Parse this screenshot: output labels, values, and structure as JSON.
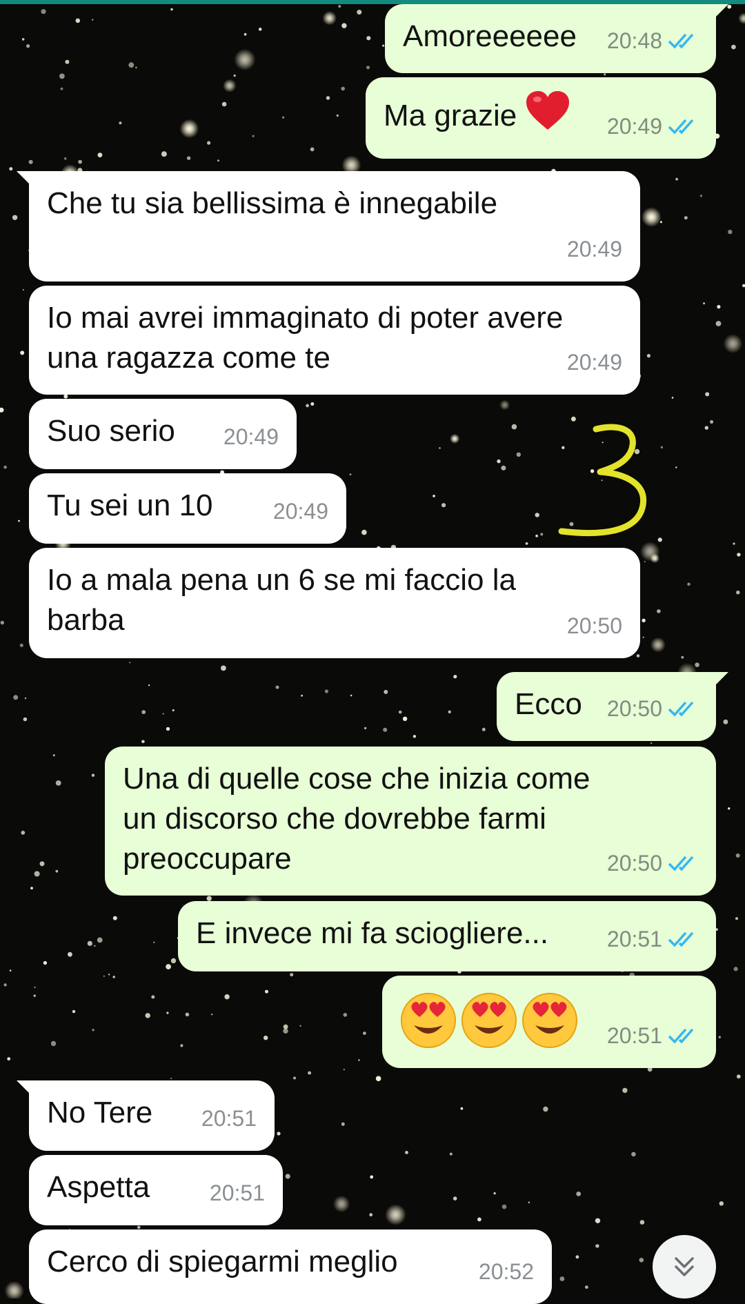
{
  "theme": {
    "incoming_bg": "#ffffff",
    "outgoing_bg": "#e7fed6",
    "read_tick_color": "#34b7f1",
    "annotation_color": "#e3e32a"
  },
  "messages": [
    {
      "side": "out",
      "text": "Amoreeeeee",
      "time": "20:48",
      "ticks": "read"
    },
    {
      "side": "out",
      "text": "Ma grazie",
      "emoji": "red-heart",
      "time": "20:49",
      "ticks": "read"
    },
    {
      "side": "in",
      "text": "Che tu sia bellissima è innegabile",
      "time": "20:49"
    },
    {
      "side": "in",
      "text": "Io mai avrei immaginato di poter avere\nuna ragazza come te",
      "time": "20:49"
    },
    {
      "side": "in",
      "text": "Suo serio",
      "time": "20:49"
    },
    {
      "side": "in",
      "text": "Tu sei un 10",
      "time": "20:49"
    },
    {
      "side": "in",
      "text": "Io a mala pena un 6 se mi faccio la\nbarba",
      "time": "20:50"
    },
    {
      "side": "out",
      "text": "Ecco",
      "time": "20:50",
      "ticks": "read"
    },
    {
      "side": "out",
      "text": "Una di quelle cose che inizia come\nun discorso che dovrebbe farmi\npreoccupare",
      "time": "20:50",
      "ticks": "read"
    },
    {
      "side": "out",
      "text": "E invece mi fa sciogliere...",
      "time": "20:51",
      "ticks": "read"
    },
    {
      "side": "out",
      "emojis": [
        "heart-eyes-face",
        "heart-eyes-face",
        "heart-eyes-face"
      ],
      "time": "20:51",
      "ticks": "read"
    },
    {
      "side": "in",
      "text": "No Tere",
      "time": "20:51"
    },
    {
      "side": "in",
      "text": "Aspetta",
      "time": "20:51"
    },
    {
      "side": "in",
      "text": "Cerco di spiegarmi meglio",
      "time": "20:52"
    }
  ],
  "annotation": {
    "text": "3"
  },
  "scroll_button": {
    "icon": "double-chevron-down-icon"
  }
}
